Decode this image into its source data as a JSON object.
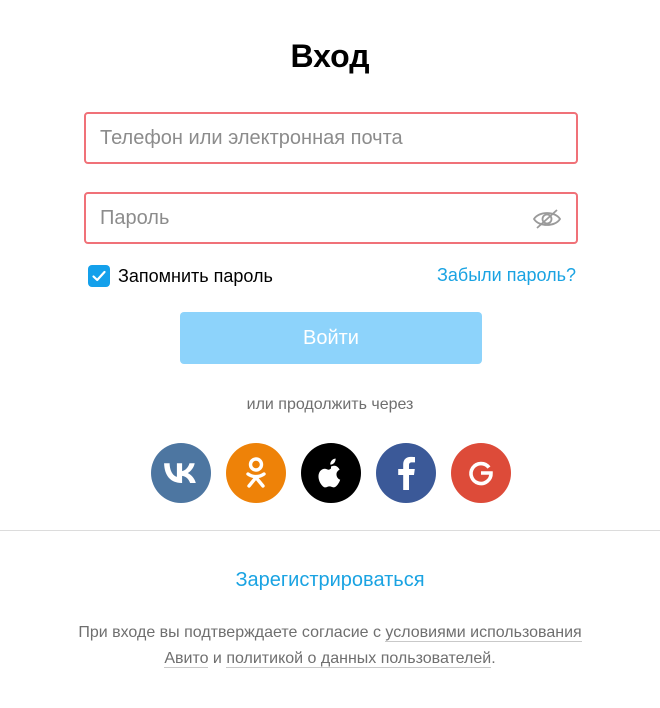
{
  "title": "Вход",
  "login_field": {
    "placeholder": "Телефон или электронная почта",
    "value": ""
  },
  "password_field": {
    "placeholder": "Пароль",
    "value": "",
    "toggle_icon": "eye-crossed-icon"
  },
  "remember": {
    "label": "Запомнить пароль",
    "checked": true
  },
  "forgot_link": "Забыли пароль?",
  "login_button": "Войти",
  "social_caption": "или продолжить через",
  "socials": [
    {
      "name": "vk",
      "icon": "vk-icon",
      "color": "#4d76a1"
    },
    {
      "name": "odnoklassniki",
      "icon": "odnoklassniki-icon",
      "color": "#ee8208"
    },
    {
      "name": "apple",
      "icon": "apple-icon",
      "color": "#000000"
    },
    {
      "name": "facebook",
      "icon": "facebook-icon",
      "color": "#3b5998"
    },
    {
      "name": "google",
      "icon": "google-icon",
      "color": "#dd4b39"
    }
  ],
  "register_link": "Зарегистрироваться",
  "terms": {
    "prefix": "При входе вы подтверждаете согласие с ",
    "link1": "условиями использования Авито",
    "middle": " и ",
    "link2": "политикой о данных пользователей",
    "suffix": "."
  },
  "colors": {
    "accent": "#1aa3e2",
    "error_border": "#f07178",
    "button_disabled": "#8dd3fb",
    "checkbox": "#14a0eb"
  }
}
